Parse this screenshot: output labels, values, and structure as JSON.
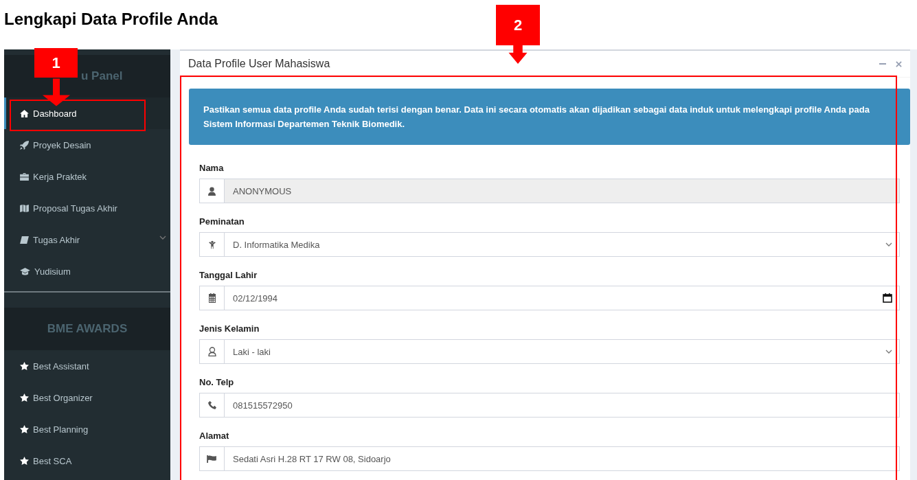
{
  "page_title": "Lengkapi Data Profile Anda",
  "annotations": [
    {
      "label": "1"
    },
    {
      "label": "2"
    }
  ],
  "sidebar": {
    "sections": [
      {
        "title": "u Panel",
        "items": [
          {
            "label": "Dashboard",
            "selected": true
          },
          {
            "label": "Proyek Desain",
            "selected": false
          },
          {
            "label": "Kerja Praktek",
            "selected": false
          },
          {
            "label": "Proposal Tugas Akhir",
            "selected": false
          },
          {
            "label": "Tugas Akhir",
            "selected": false,
            "expanded": false
          },
          {
            "label": "Yudisium",
            "selected": false
          }
        ]
      },
      {
        "title": "BME AWARDS",
        "items": [
          {
            "label": "Best Assistant",
            "selected": false
          },
          {
            "label": "Best Organizer",
            "selected": false
          },
          {
            "label": "Best Planning",
            "selected": false
          },
          {
            "label": "Best SCA",
            "selected": false
          }
        ]
      }
    ]
  },
  "panel": {
    "title": "Data Profile User Mahasiswa",
    "callout": "Pastikan semua data profile Anda sudah terisi dengan benar. Data ini secara otomatis akan dijadikan sebagai data induk untuk melengkapi profile Anda pada Sistem Informasi Departemen Teknik Biomedik.",
    "fields": [
      {
        "label": "Nama",
        "kind": "text",
        "value": "ANONYMOUS",
        "disabled": true
      },
      {
        "label": "Peminatan",
        "kind": "select",
        "value": "D. Informatika Medika",
        "disabled": false
      },
      {
        "label": "Tanggal Lahir",
        "kind": "date",
        "value": "02/12/1994",
        "disabled": false
      },
      {
        "label": "Jenis Kelamin",
        "kind": "select",
        "value": "Laki - laki",
        "disabled": false
      },
      {
        "label": "No. Telp",
        "kind": "text",
        "value": "081515572950",
        "disabled": false
      },
      {
        "label": "Alamat",
        "kind": "text",
        "value": "Sedati Asri H.28 RT 17 RW 08, Sidoarjo",
        "disabled": false
      }
    ]
  }
}
